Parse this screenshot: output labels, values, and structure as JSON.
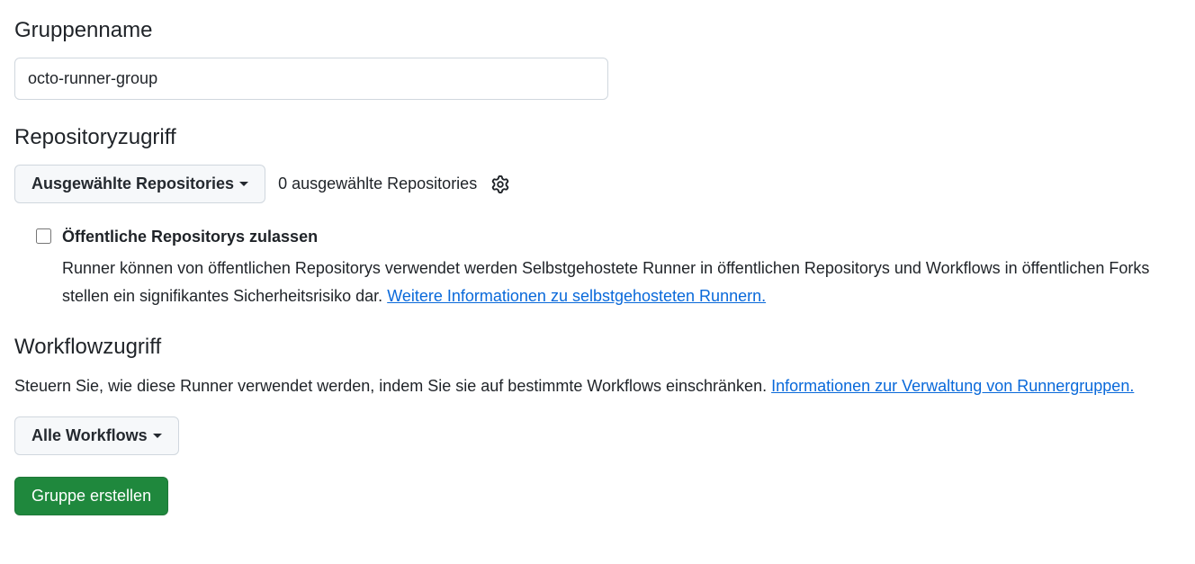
{
  "groupName": {
    "label": "Gruppenname",
    "value": "octo-runner-group"
  },
  "repoAccess": {
    "label": "Repositoryzugriff",
    "dropdownLabel": "Ausgewählte Repositories",
    "countText": "0 ausgewählte Repositories",
    "checkbox": {
      "label": "Öffentliche Repositorys zulassen",
      "description": "Runner können von öffentlichen Repositorys verwendet werden Selbstgehostete Runner in öffentlichen Repositorys und Workflows in öffentlichen Forks stellen ein signifikantes Sicherheitsrisiko dar.  ",
      "linkText": "Weitere Informationen zu selbstgehosteten Runnern."
    }
  },
  "workflowAccess": {
    "label": "Workflowzugriff",
    "description": "Steuern Sie, wie diese Runner verwendet werden, indem Sie sie auf bestimmte Workflows einschränken. ",
    "linkText": "Informationen zur Verwaltung von Runnergruppen.",
    "dropdownLabel": "Alle Workflows"
  },
  "createButton": {
    "label": "Gruppe erstellen"
  }
}
